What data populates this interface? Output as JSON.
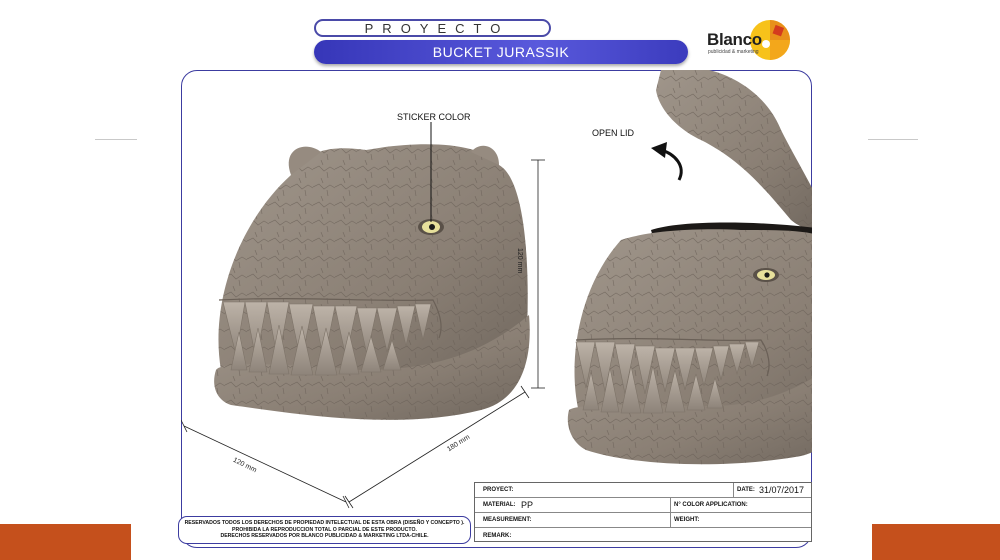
{
  "header": {
    "project_label": "PROYECTO",
    "title": "BUCKET JURASSIK"
  },
  "logo": {
    "name": "Blanco",
    "tagline": "publicidad & marketing"
  },
  "annotations": {
    "sticker_color": "STICKER COLOR",
    "open_lid": "OPEN LID",
    "height_dim": "120 mm",
    "width_dim": "120 mm",
    "depth_dim": "180 mm"
  },
  "rights": {
    "lines": [
      "RESERVADOS TODOS LOS DERECHOS DE PROPIEDAD INTELECTUAL DE ESTA OBRA (DISEÑO Y CONCEPTO ).",
      "PROHIBIDA LA REPRODUCCION TOTAL O PARCIAL DE ESTE PRODUCTO.",
      "DERECHOS RESERVADOS POR BLANCO PUBLICIDAD & MARKETING LTDA-CHILE."
    ]
  },
  "spec": {
    "proyect_label": "PROYECT:",
    "date_label": "DATE:",
    "date_value": "31/07/2017",
    "material_label": "MATERIAL:",
    "material_value": "PP",
    "color_app_label": "N° COLOR APPLICATION:",
    "measurement_label": "MEASUREMENT:",
    "weight_label": "WEIGHT:",
    "remark_label": "REMARK:"
  },
  "colors": {
    "accent_blue": "#3c3ca0",
    "bar_blue": "#4a4ac8",
    "band_orange": "#c5501c",
    "dino_gray": "#8f8479"
  }
}
